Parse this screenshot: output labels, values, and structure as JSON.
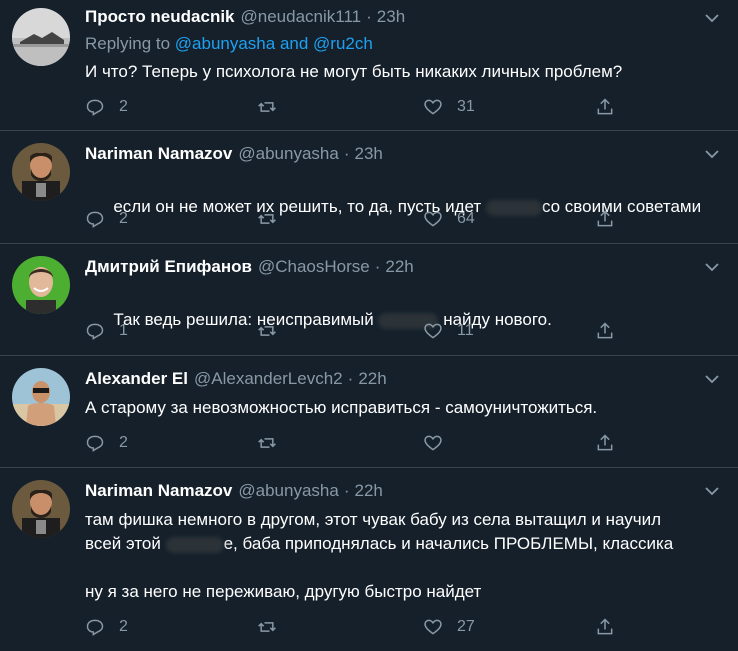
{
  "tweets": [
    {
      "name": "Просто neudacnik",
      "handle": "@neudacnik111",
      "time": "23h",
      "replying_prefix": "Replying to ",
      "replying_1": "@abunyasha",
      "replying_and": " and ",
      "replying_2": "@ru2ch",
      "text": "И что? Теперь у психолога не могут быть никаких личных проблем?",
      "replies": "2",
      "retweets": "",
      "likes": "31"
    },
    {
      "name": "Nariman Namazov",
      "handle": "@abunyasha",
      "time": "23h",
      "text_before": "если он не может их решить, то да, пусть идет ",
      "text_after": "со своими советами",
      "replies": "2",
      "retweets": "",
      "likes": "64"
    },
    {
      "name": "Дмитрий Епифанов",
      "handle": "@ChaosHorse",
      "time": "22h",
      "text_before": "Так ведь решила: неисправимый ",
      "text_after": " найду нового.",
      "replies": "1",
      "retweets": "",
      "likes": "11"
    },
    {
      "name": "Alexander El",
      "handle": "@AlexanderLevch2",
      "time": "22h",
      "text": "А старому за невозможностью исправиться - самоуничтожиться.",
      "replies": "2",
      "retweets": "",
      "likes": ""
    },
    {
      "name": "Nariman Namazov",
      "handle": "@abunyasha",
      "time": "22h",
      "line1": "там фишка немного в другом, этот чувак бабу из села вытащил и научил",
      "line2_before": "всей этой ",
      "line2_after": "е, баба приподнялась и начались ПРОБЛЕМЫ, классика",
      "line3": "ну я за него не переживаю, другую быстро найдет",
      "replies": "2",
      "retweets": "",
      "likes": "27"
    }
  ],
  "separator": "·",
  "icons": [
    "reply-icon",
    "retweet-icon",
    "like-icon",
    "share-icon",
    "chevron-down-icon"
  ],
  "colors": {
    "background": "#15202b",
    "secondary": "#8899a6",
    "link": "#1da1f2",
    "border": "#38444d"
  }
}
